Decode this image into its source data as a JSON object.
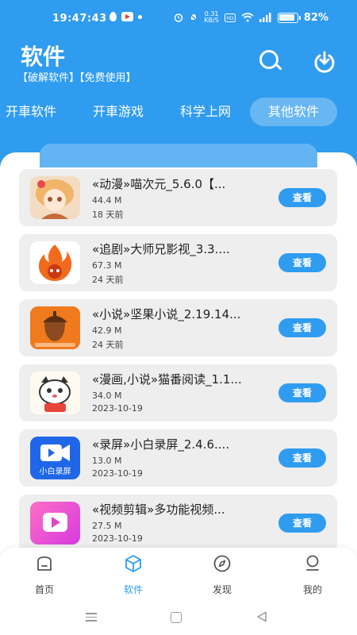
{
  "status_bar": {
    "time": "19:47:43",
    "net_speed_value": "0.31",
    "net_speed_unit": "KB/S",
    "battery": "82%"
  },
  "header": {
    "title": "软件",
    "subtitle": "【破解软件】【免费使用】",
    "search_icon": "search-icon",
    "download_icon": "download-icon"
  },
  "tabs": [
    {
      "label": "开車软件",
      "active": false
    },
    {
      "label": "开車游戏",
      "active": false
    },
    {
      "label": "科学上网",
      "active": false
    },
    {
      "label": "其他软件",
      "active": true
    }
  ],
  "apps": [
    {
      "name": "«动漫»喵次元_5.6.0【...",
      "size": "44.4 M",
      "date": "18 天前",
      "button": "查看",
      "icon": "anime-girl-icon"
    },
    {
      "name": "«追剧»大师兄影视_3.3....",
      "size": "67.3 M",
      "date": "24 天前",
      "button": "查看",
      "icon": "flame-icon"
    },
    {
      "name": "«小说»坚果小说_2.19.14...",
      "size": "42.9 M",
      "date": "24 天前",
      "button": "查看",
      "icon": "acorn-icon"
    },
    {
      "name": "«漫画,小说»猫番阅读_1.1...",
      "size": "34.0 M",
      "date": "2023-10-19",
      "button": "查看",
      "icon": "cat-icon"
    },
    {
      "name": "«录屏»小白录屏_2.4.6....",
      "size": "13.0 M",
      "date": "2023-10-19",
      "button": "查看",
      "icon": "video-camera-icon",
      "icon_label": "小白录屏"
    },
    {
      "name": "«视频剪辑»多功能视频...",
      "size": "27.5 M",
      "date": "2023-10-19",
      "button": "查看",
      "icon": "play-icon"
    }
  ],
  "bottom_nav": [
    {
      "label": "首页",
      "icon": "home-icon",
      "active": false
    },
    {
      "label": "软件",
      "icon": "cube-icon",
      "active": true
    },
    {
      "label": "发现",
      "icon": "compass-icon",
      "active": false
    },
    {
      "label": "我的",
      "icon": "user-icon",
      "active": false
    }
  ],
  "colors": {
    "primary": "#2f9cef",
    "card_bg": "#eeeeee",
    "tab_active_bg": "rgba(255,255,255,0.28)"
  }
}
